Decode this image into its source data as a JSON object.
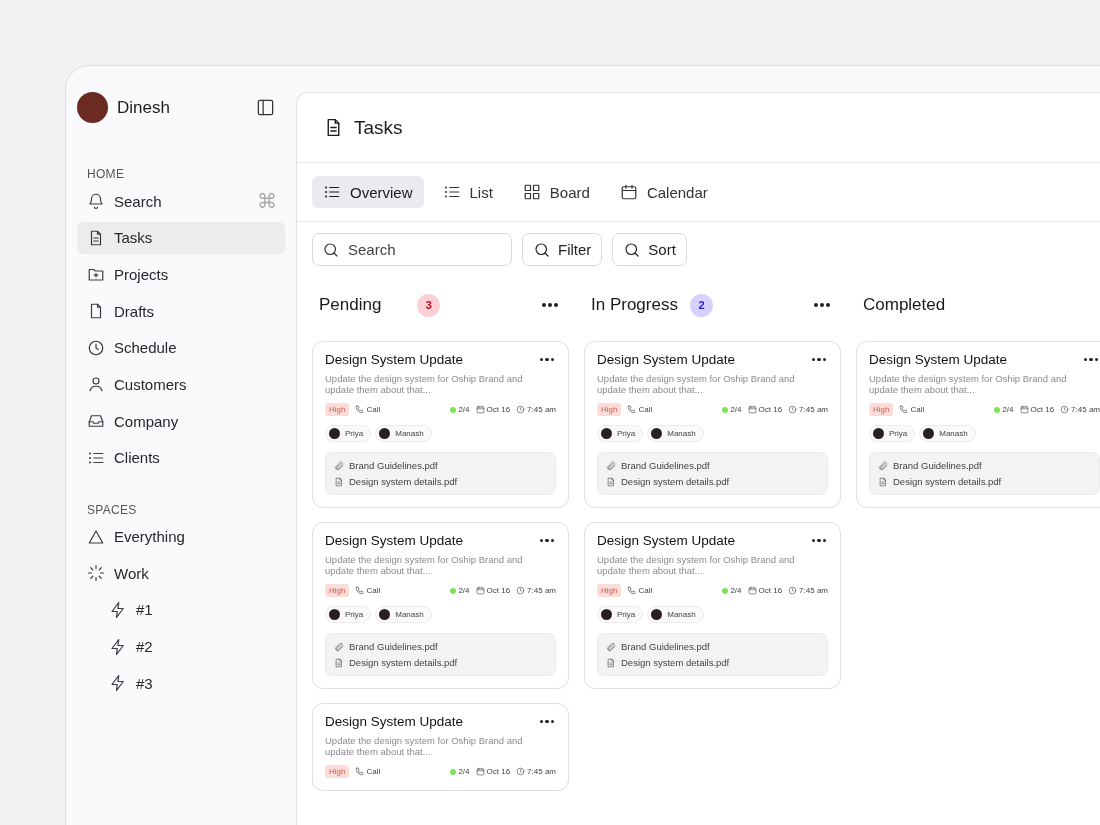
{
  "user": {
    "name": "Dinesh"
  },
  "sidebar": {
    "sections": [
      {
        "title": "HOME",
        "items": [
          {
            "label": "Search",
            "shortcut": "⌘",
            "selected": false
          },
          {
            "label": "Tasks",
            "selected": true
          },
          {
            "label": "Projects",
            "selected": false
          },
          {
            "label": "Drafts",
            "selected": false
          },
          {
            "label": "Schedule",
            "selected": false
          },
          {
            "label": "Customers",
            "selected": false
          },
          {
            "label": "Company",
            "selected": false
          },
          {
            "label": "Clients",
            "selected": false
          }
        ]
      },
      {
        "title": "SPACES",
        "items": [
          {
            "label": "Everything",
            "selected": false
          },
          {
            "label": "Work",
            "selected": false,
            "children": [
              {
                "label": "#1",
                "selected": false
              },
              {
                "label": "#2",
                "selected": false
              },
              {
                "label": "#3",
                "selected": false
              }
            ]
          }
        ]
      }
    ]
  },
  "page": {
    "title": "Tasks"
  },
  "tabs": [
    {
      "label": "Overview",
      "selected": true
    },
    {
      "label": "List",
      "selected": false
    },
    {
      "label": "Board",
      "selected": false
    },
    {
      "label": "Calendar",
      "selected": false
    }
  ],
  "toolbar": {
    "search": {
      "placeholder": "Search"
    },
    "buttons": [
      "Filter",
      "Sort"
    ]
  },
  "columns": [
    {
      "title": "Pending",
      "count": "3",
      "color": "#fbcfd6",
      "cards": [
        {
          "title": "Design System Update",
          "description": "Update the design system for Oship Brand and update them about that...",
          "priority": "High",
          "type": "Call",
          "subtasks": "2/4",
          "date": "Oct 16",
          "time": "7:45 am",
          "people": [
            "Priya",
            "Manash"
          ],
          "files": [
            "Brand Guidelines.pdf",
            "Design system details.pdf"
          ]
        },
        {
          "title": "Design System Update",
          "description": "Update the design system for Oship Brand and update them about that...",
          "priority": "High",
          "type": "Call",
          "subtasks": "2/4",
          "date": "Oct 16",
          "time": "7:45 am",
          "people": [
            "Priya",
            "Manash"
          ],
          "files": [
            "Brand Guidelines.pdf",
            "Design system details.pdf"
          ]
        },
        {
          "title": "Design System Update",
          "description": "Update the design system for Oship Brand and update them about that...",
          "priority": "High",
          "type": "Call",
          "subtasks": "2/4",
          "date": "Oct 16",
          "time": "7:45 am"
        }
      ]
    },
    {
      "title": "In Progress",
      "count": "2",
      "color": "#d6d0fb",
      "cards": [
        {
          "title": "Design System Update",
          "description": "Update the design system for Oship Brand and update them about that...",
          "priority": "High",
          "type": "Call",
          "subtasks": "2/4",
          "date": "Oct 16",
          "time": "7:45 am",
          "people": [
            "Priya",
            "Manash"
          ],
          "files": [
            "Brand Guidelines.pdf",
            "Design system details.pdf"
          ]
        },
        {
          "title": "Design System Update",
          "description": "Update the design system for Oship Brand and update them about that...",
          "priority": "High",
          "type": "Call",
          "subtasks": "2/4",
          "date": "Oct 16",
          "time": "7:45 am",
          "people": [
            "Priya",
            "Manash"
          ],
          "files": [
            "Brand Guidelines.pdf",
            "Design system details.pdf"
          ]
        }
      ]
    },
    {
      "title": "Completed",
      "cards": [
        {
          "title": "Design System Update",
          "description": "Update the design system for Oship Brand and update them about that...",
          "priority": "High",
          "type": "Call",
          "subtasks": "2/4",
          "date": "Oct 16",
          "time": "7:45 am",
          "people": [
            "Priya",
            "Manash"
          ],
          "files": [
            "Brand Guidelines.pdf",
            "Design system details.pdf"
          ]
        }
      ]
    }
  ]
}
